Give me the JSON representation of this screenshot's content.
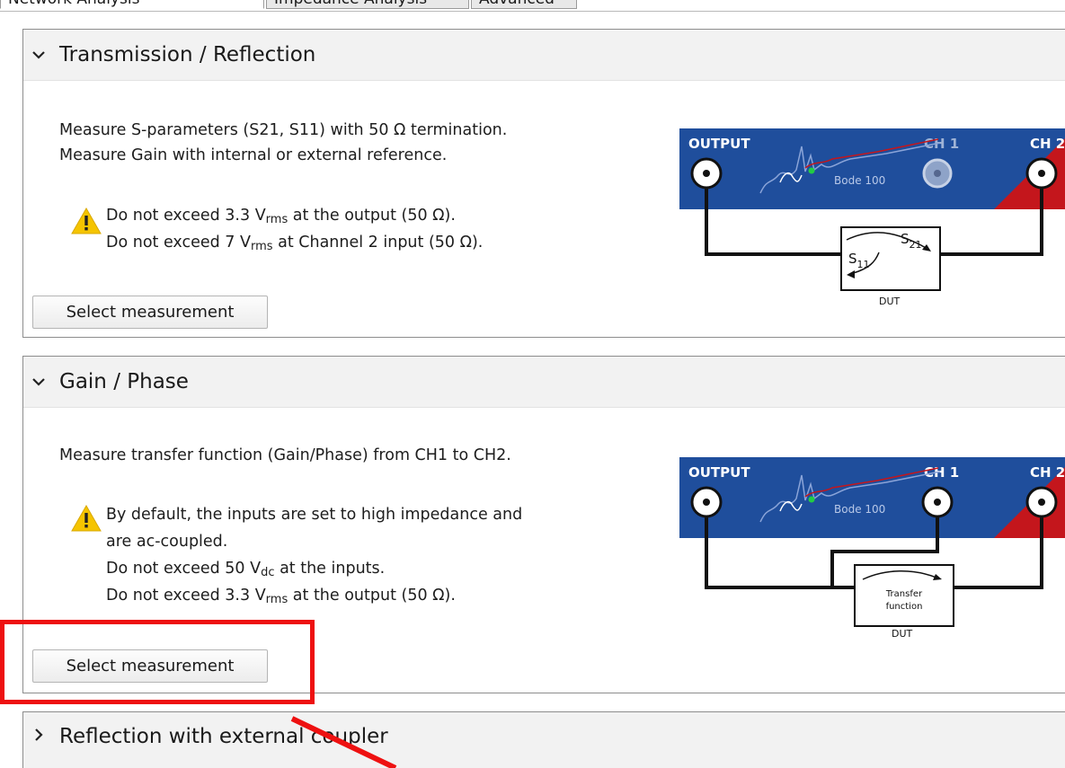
{
  "tabs": [
    {
      "label": "Network Analysis",
      "active": true
    },
    {
      "label": "Impedance Analysis",
      "active": false
    },
    {
      "label": "Advanced",
      "active": false
    }
  ],
  "panels": [
    {
      "title": "Transmission / Reflection",
      "expanded": true,
      "description": [
        "Measure S-parameters (S21, S11) with 50 Ω termination.",
        "Measure Gain with internal or external reference."
      ],
      "warnings": [
        {
          "pre": "Do not exceed 3.3 V",
          "sub": "rms",
          "post": " at the output (50 Ω)."
        },
        {
          "pre": "Do not exceed 7 V",
          "sub": "rms",
          "post": " at Channel 2 input (50 Ω)."
        }
      ],
      "button_label": "Select measurement",
      "diagram": {
        "output_label": "OUTPUT",
        "ch1_label": "CH 1",
        "ch2_label": "CH 2",
        "device_label": "Bode 100",
        "dut_label": "DUT",
        "s21_label": "S",
        "s21_sub": "21",
        "s11_label": "S",
        "s11_sub": "11"
      }
    },
    {
      "title": "Gain / Phase",
      "expanded": true,
      "description": [
        "Measure transfer function (Gain/Phase) from CH1 to CH2."
      ],
      "warnings": [
        {
          "pre": "By default, the inputs are set to high impedance and",
          "sub": "",
          "post": ""
        },
        {
          "pre": "are ac-coupled.",
          "sub": "",
          "post": ""
        },
        {
          "pre": "Do not exceed 50 V",
          "sub": "dc",
          "post": " at the inputs."
        },
        {
          "pre": "Do not exceed 3.3 V",
          "sub": "rms",
          "post": " at the output (50 Ω)."
        }
      ],
      "button_label": "Select measurement",
      "diagram": {
        "output_label": "OUTPUT",
        "ch1_label": "CH 1",
        "ch2_label": "CH 2",
        "device_label": "Bode 100",
        "dut_label": "DUT",
        "tf_line1": "Transfer",
        "tf_line2": "function"
      }
    },
    {
      "title": "Reflection with external coupler",
      "expanded": false
    }
  ],
  "colors": {
    "device_blue": "#1f4e9c",
    "device_red": "#c4161c",
    "highlight_red": "#ee1111",
    "warning_yellow": "#f5c400"
  },
  "icons": {
    "expanded": "chevron-down-icon",
    "collapsed": "chevron-right-icon",
    "warning": "warning-triangle-icon"
  }
}
